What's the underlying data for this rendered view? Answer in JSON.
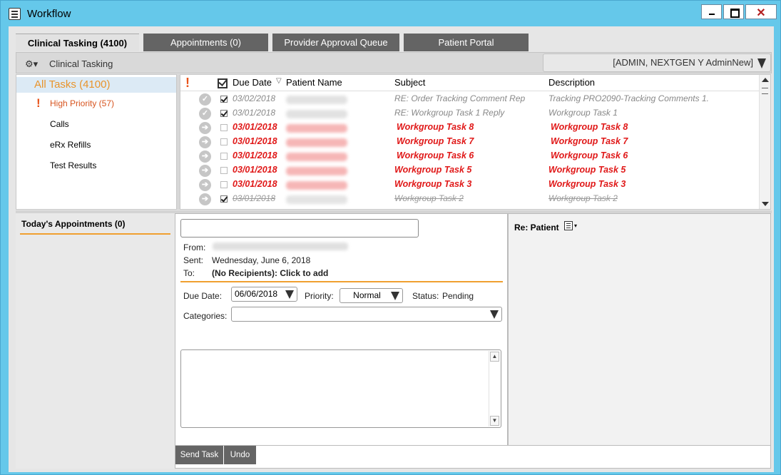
{
  "window": {
    "title": "Workflow",
    "close_glyph": "✕"
  },
  "tabs": [
    {
      "label": "Clinical Tasking (4100)",
      "active": true
    },
    {
      "label": "Appointments (0)",
      "active": false
    },
    {
      "label": "Provider Approval Queue",
      "active": false
    },
    {
      "label": "Patient Portal",
      "active": false
    }
  ],
  "toolbar": {
    "gear_glyph": "⚙▾",
    "title": "Clinical Tasking",
    "user": "[ADMIN, NEXTGEN Y AdminNew]"
  },
  "nav": {
    "all_tasks": "All Tasks (4100)",
    "high_priority": "High Priority (57)",
    "calls": "Calls",
    "erx_refills": "eRx Refills",
    "test_results": "Test Results",
    "bang": "!"
  },
  "task_table": {
    "columns": {
      "priority": "!",
      "due_date": "Due Date",
      "sort_glyph": "▽",
      "patient": "Patient Name",
      "subject": "Subject",
      "description": "Description"
    },
    "rows": [
      {
        "due": "03/02/2018",
        "subject": "RE: Order Tracking Comment Rep",
        "description": "Tracking PRO2090-Tracking Comments 1.",
        "status": "done",
        "checked": true,
        "icon": "✓"
      },
      {
        "due": "03/01/2018",
        "subject": "RE: Workgroup Task 1 Reply",
        "description": "Workgroup Task 1",
        "status": "done",
        "checked": true,
        "icon": "✓"
      },
      {
        "due": "03/01/2018",
        "subject": "Workgroup Task 8",
        "description": "Workgroup Task 8",
        "status": "urgent",
        "checked": false,
        "icon": "➔"
      },
      {
        "due": "03/01/2018",
        "subject": "Workgroup Task 7",
        "description": "Workgroup Task 7",
        "status": "urgent",
        "checked": false,
        "icon": "➔"
      },
      {
        "due": "03/01/2018",
        "subject": "Workgroup Task 6",
        "description": "Workgroup Task 6",
        "status": "urgent",
        "checked": false,
        "icon": "➔"
      },
      {
        "due": "03/01/2018",
        "subject": "Workgroup Task 5",
        "description": "Workgroup Task 5",
        "status": "urgent",
        "checked": false,
        "icon": "➔"
      },
      {
        "due": "03/01/2018",
        "subject": "Workgroup Task 3",
        "description": "Workgroup Task 3",
        "status": "urgent",
        "checked": false,
        "icon": "➔"
      },
      {
        "due": "03/01/2018",
        "subject": "Workgroup Task 2",
        "description": "Workgroup Task 2",
        "status": "strike",
        "checked": true,
        "icon": "➔"
      }
    ]
  },
  "appointments": {
    "title": "Today's Appointments (0)"
  },
  "detail": {
    "from_label": "From:",
    "sent_label": "Sent:",
    "sent_value": "Wednesday, June 6, 2018",
    "to_label": "To:",
    "to_value": "(No Recipients): Click to add",
    "due_date_label": "Due Date:",
    "due_date_value": "06/06/2018",
    "priority_label": "Priority:",
    "priority_value": "Normal",
    "status_label": "Status:",
    "status_value": "Pending",
    "categories_label": "Categories:",
    "subject_value": "",
    "scroll_up": "▲",
    "scroll_down": "▼"
  },
  "buttons": {
    "send_task": "Send Task",
    "undo": "Undo"
  },
  "re_patient": {
    "label": "Re: Patient",
    "caret": "▾"
  }
}
